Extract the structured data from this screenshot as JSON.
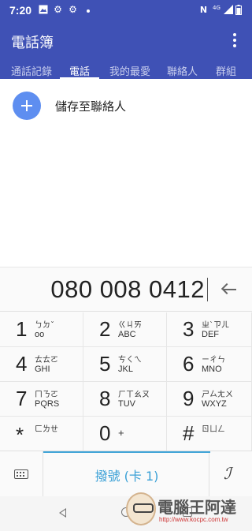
{
  "status_bar": {
    "time": "7:20",
    "left_icons": [
      "image-icon",
      "gear-icon",
      "gear-icon",
      "dot-icon"
    ],
    "right_icons": [
      "nfc-icon",
      "network-4g-icon",
      "signal-icon",
      "battery-icon"
    ],
    "network_label": "4G"
  },
  "app_bar": {
    "title": "電話簿",
    "tabs": [
      {
        "label": "通話記錄"
      },
      {
        "label": "電話"
      },
      {
        "label": "我的最愛"
      },
      {
        "label": "聯絡人"
      },
      {
        "label": "群組"
      }
    ],
    "active_tab": "電話",
    "color": "#3f51b5"
  },
  "content": {
    "add_contact_label": "儲存至聯絡人"
  },
  "dialer": {
    "number": "080 008 0412",
    "keys": [
      {
        "digit": "1",
        "zhuyin": "ㄅㄉˇ",
        "letters": "oo"
      },
      {
        "digit": "2",
        "zhuyin": "ㄍㄐㄞ",
        "letters": "ABC"
      },
      {
        "digit": "3",
        "zhuyin": "ㄓˋㄗㄦ",
        "letters": "DEF"
      },
      {
        "digit": "4",
        "zhuyin": "ㄊㄊㄛ",
        "letters": "GHI"
      },
      {
        "digit": "5",
        "zhuyin": "ㄘㄑㄟ",
        "letters": "JKL"
      },
      {
        "digit": "6",
        "zhuyin": "ㄧㄔㄣ",
        "letters": "MNO"
      },
      {
        "digit": "7",
        "zhuyin": "ㄇㄋㄛ",
        "letters": "PQRS"
      },
      {
        "digit": "8",
        "zhuyin": "ㄏㄒㄠㄡ",
        "letters": "TUV"
      },
      {
        "digit": "9",
        "zhuyin": "ㄕㄙㄤㄨ",
        "letters": "WXYZ"
      },
      {
        "digit": "*",
        "zhuyin": "ㄈㄌㄝ",
        "letters": ""
      },
      {
        "digit": "0",
        "zhuyin": "",
        "letters": "+"
      },
      {
        "digit": "#",
        "zhuyin": "ㄖㄩㄥ",
        "letters": ""
      }
    ],
    "call_label": "撥號 (卡 1)",
    "call_color": "#3aa0d6"
  },
  "watermark": {
    "text": "電腦王阿達",
    "url": "http://www.kocpc.com.tw"
  }
}
